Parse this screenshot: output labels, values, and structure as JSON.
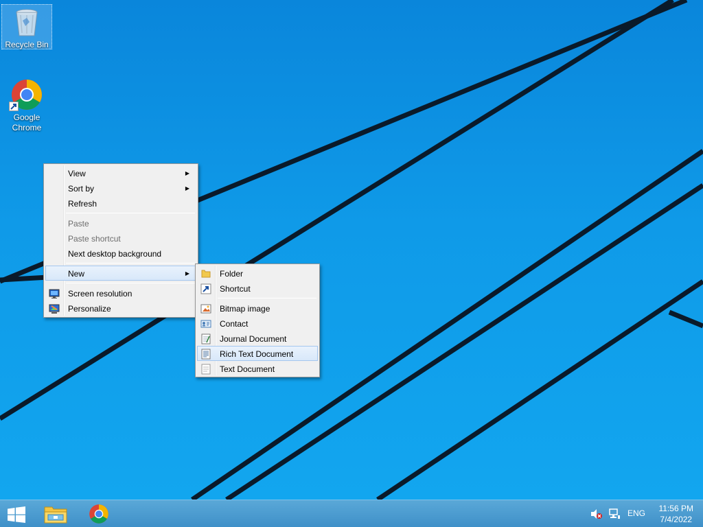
{
  "desktop": {
    "icons": [
      {
        "label": "Recycle Bin"
      },
      {
        "label": "Google Chrome"
      }
    ]
  },
  "context_menu": {
    "items": {
      "view": "View",
      "sort_by": "Sort by",
      "refresh": "Refresh",
      "paste": "Paste",
      "paste_shortcut": "Paste shortcut",
      "next_background": "Next desktop background",
      "new": "New",
      "screen_resolution": "Screen resolution",
      "personalize": "Personalize"
    }
  },
  "new_submenu": {
    "items": {
      "folder": "Folder",
      "shortcut": "Shortcut",
      "bitmap": "Bitmap image",
      "contact": "Contact",
      "journal": "Journal Document",
      "rtf": "Rich Text Document",
      "text": "Text Document"
    }
  },
  "taskbar": {
    "language": "ENG",
    "time": "11:56 PM",
    "date": "7/4/2022"
  }
}
